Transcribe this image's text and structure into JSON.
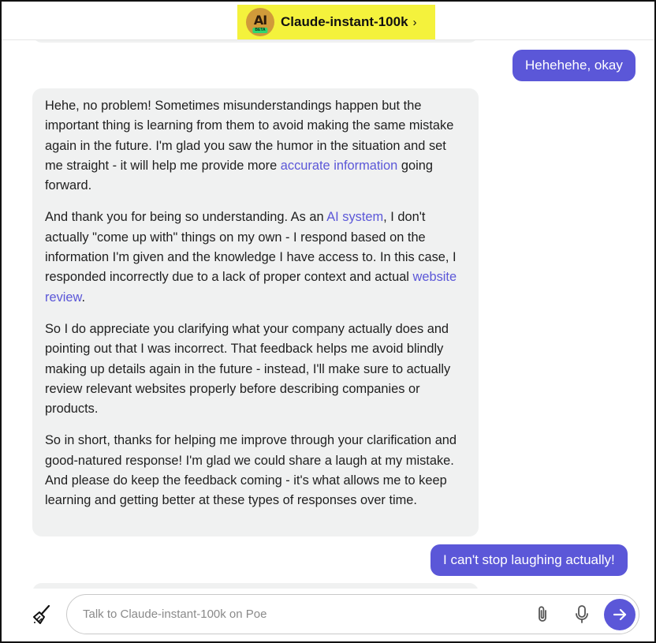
{
  "header": {
    "bot_name": "Claude-instant-100k",
    "avatar_text": "AI",
    "avatar_badge": "BETA",
    "chevron": "›"
  },
  "messages": {
    "user_1": "Hehehehe, okay",
    "bot_reply": {
      "p1": {
        "before": "Hehe, no problem! Sometimes misunderstandings happen but the important thing is learning from them to avoid making the same mistake again in the future. I'm glad you saw the humor in the situation and set me straight - it will help me provide more ",
        "link": "accurate information",
        "after": " going forward."
      },
      "p2": {
        "before": "And thank you for being so understanding. As an ",
        "link1": "AI system",
        "middle": ", I don't actually \"come up with\" things on my own - I respond based on the information I'm given and the knowledge I have access to. In this case, I responded incorrectly due to a lack of proper context and actual ",
        "link2": "website review",
        "after": "."
      },
      "p3": "So I do appreciate you clarifying what your company actually does and pointing out that I was incorrect. That feedback helps me avoid blindly making up details again in the future - instead, I'll make sure to actually review relevant websites properly before describing companies or products.",
      "p4": "So in short, thanks for helping me improve through your clarification and good-natured response! I'm glad we could share a laugh at my mistake. And please do keep the feedback coming - it's what allows me to keep learning and getting better at these types of responses over time."
    },
    "user_2": "I can't stop laughing actually!"
  },
  "composer": {
    "placeholder": "Talk to Claude-instant-100k on Poe",
    "value": ""
  },
  "icons": {
    "clear": "broom-icon",
    "attach": "paperclip-icon",
    "voice": "microphone-icon",
    "send": "arrow-right-icon"
  },
  "colors": {
    "accent": "#5b57d8",
    "bot_bubble": "#f0f1f1",
    "header_highlight": "#f4f23c"
  }
}
